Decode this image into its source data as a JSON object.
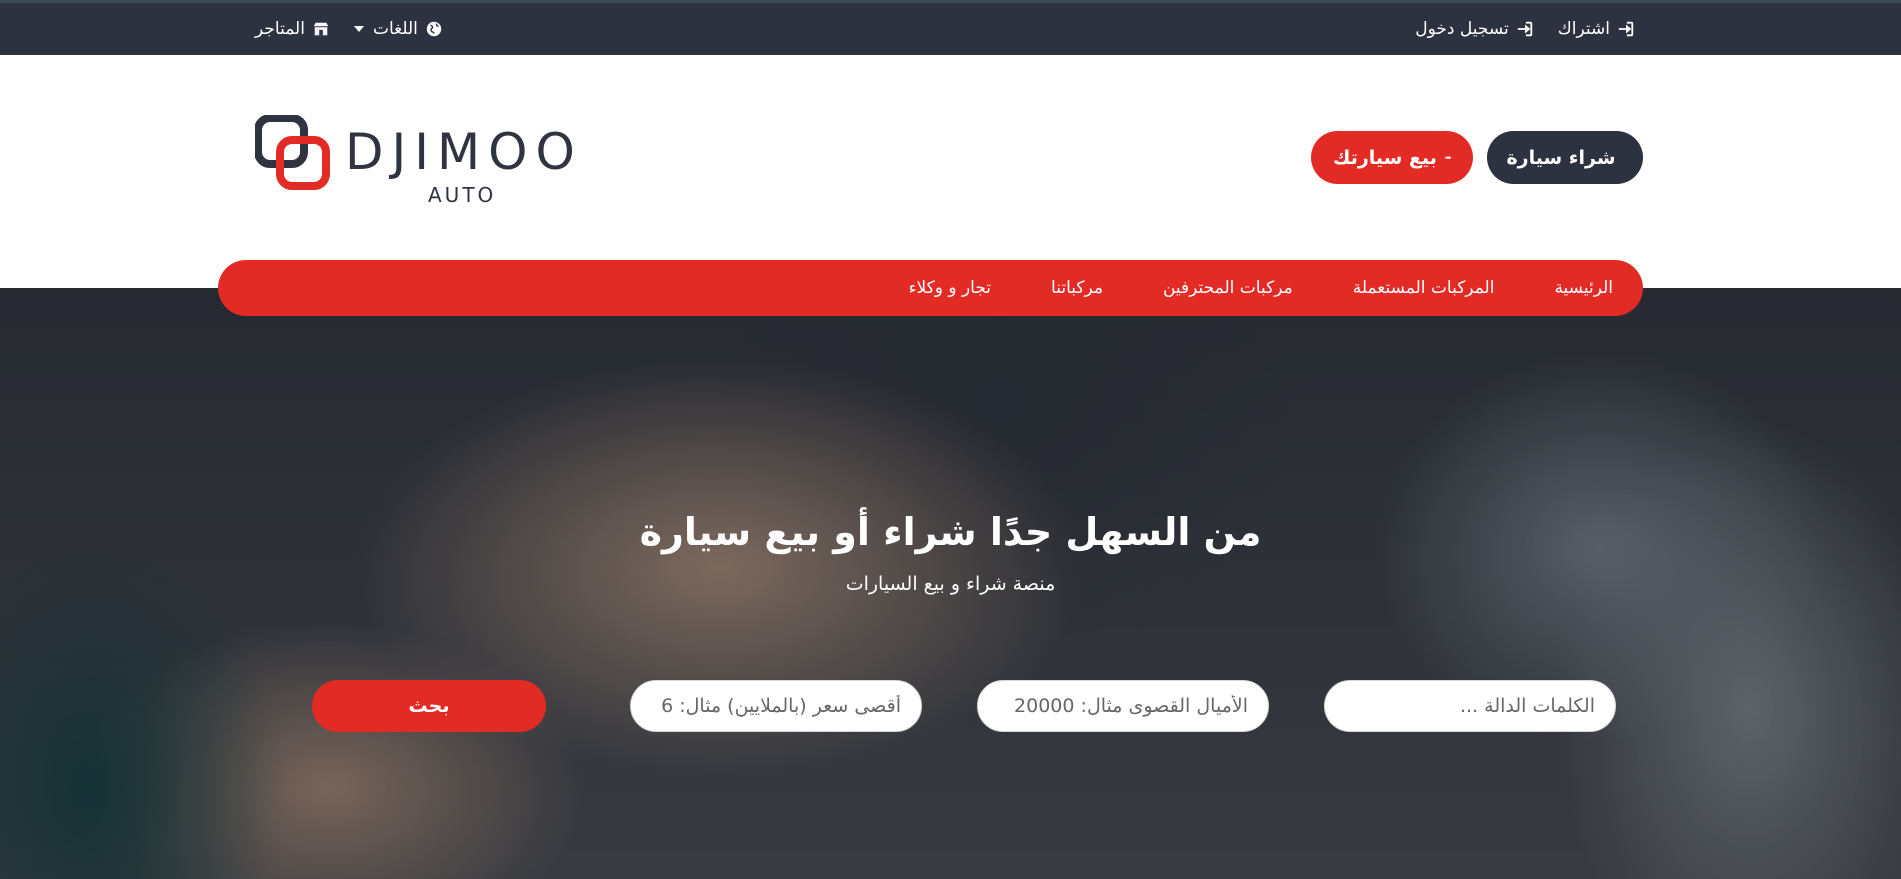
{
  "topbar": {
    "subscribe_label": "اشتراك",
    "login_label": "تسجيل دخول",
    "languages_label": "اللغات",
    "stores_label": "المتاجر"
  },
  "header": {
    "logo_text": "DJIMOO",
    "logo_subtext": "AUTO",
    "buy_button_label": "شراء سيارة",
    "sell_button_label": "بيع سيارتك"
  },
  "nav": {
    "items": [
      {
        "label": "الرئيسية"
      },
      {
        "label": "المركبات المستعملة"
      },
      {
        "label": "مركبات المحترفين"
      },
      {
        "label": "مركباتنا"
      },
      {
        "label": "تجار و وكلاء"
      }
    ]
  },
  "hero": {
    "title": "من السهل جدًا شراء أو بيع سيارة",
    "subtitle": "منصة شراء و بيع السيارات"
  },
  "search": {
    "keywords_placeholder": "الكلمات الدالة ...",
    "miles_placeholder": "الأميال القصوى مثال: 20000",
    "price_placeholder": "أقصى سعر (بالملايين) مثال: 6",
    "button_label": "بحث"
  },
  "colors": {
    "accent": "#e32b26",
    "dark": "#2d3240"
  }
}
